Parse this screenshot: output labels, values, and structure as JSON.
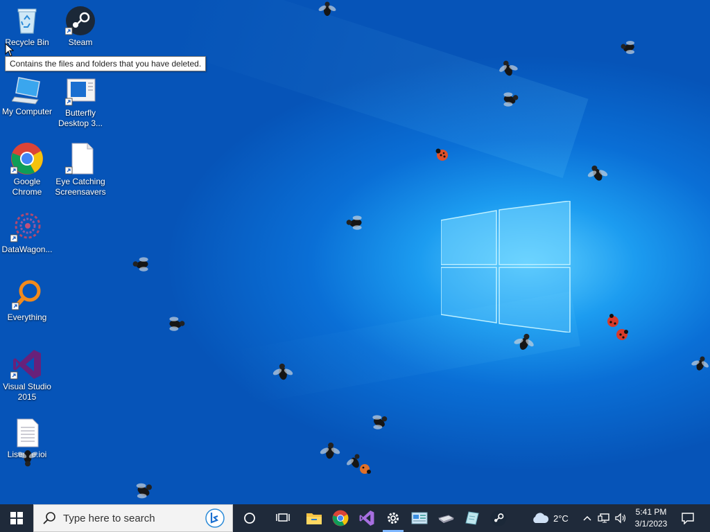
{
  "desktop": {
    "icons": [
      {
        "label": "Recycle Bin",
        "icon": "recycle-bin-icon"
      },
      {
        "label": "Steam",
        "icon": "steam-icon"
      },
      {
        "label": "My Computer",
        "icon": "computer-icon"
      },
      {
        "label": "Butterfly Desktop 3...",
        "icon": "butterfly-app-icon"
      },
      {
        "label": "Google Chrome",
        "icon": "chrome-icon"
      },
      {
        "label": "Eye Catching Screensavers",
        "icon": "document-icon"
      },
      {
        "label": "DataWagon...",
        "icon": "datawagon-icon"
      },
      {
        "label": "Everything",
        "icon": "everything-search-icon"
      },
      {
        "label": "Visual Studio 2015",
        "icon": "visual-studio-icon"
      },
      {
        "label": "Lisense.ioi",
        "icon": "text-file-icon"
      }
    ],
    "tooltip": "Contains the files and folders that you have deleted."
  },
  "taskbar": {
    "search_placeholder": "Type here to search",
    "pinned": [
      "start-icon",
      "cortana-icon",
      "task-view-icon",
      "file-explorer-icon",
      "chrome-icon",
      "visual-studio-icon",
      "settings-icon",
      "control-panel-icon",
      "drive-icon",
      "notepad-icon",
      "steam-icon"
    ],
    "weather_temp": "2°C",
    "time": "5:41 PM",
    "date": "3/1/2023"
  },
  "colors": {
    "taskbar_bg": "#1f2a3a",
    "desktop_accent": "#0a6fd6"
  }
}
